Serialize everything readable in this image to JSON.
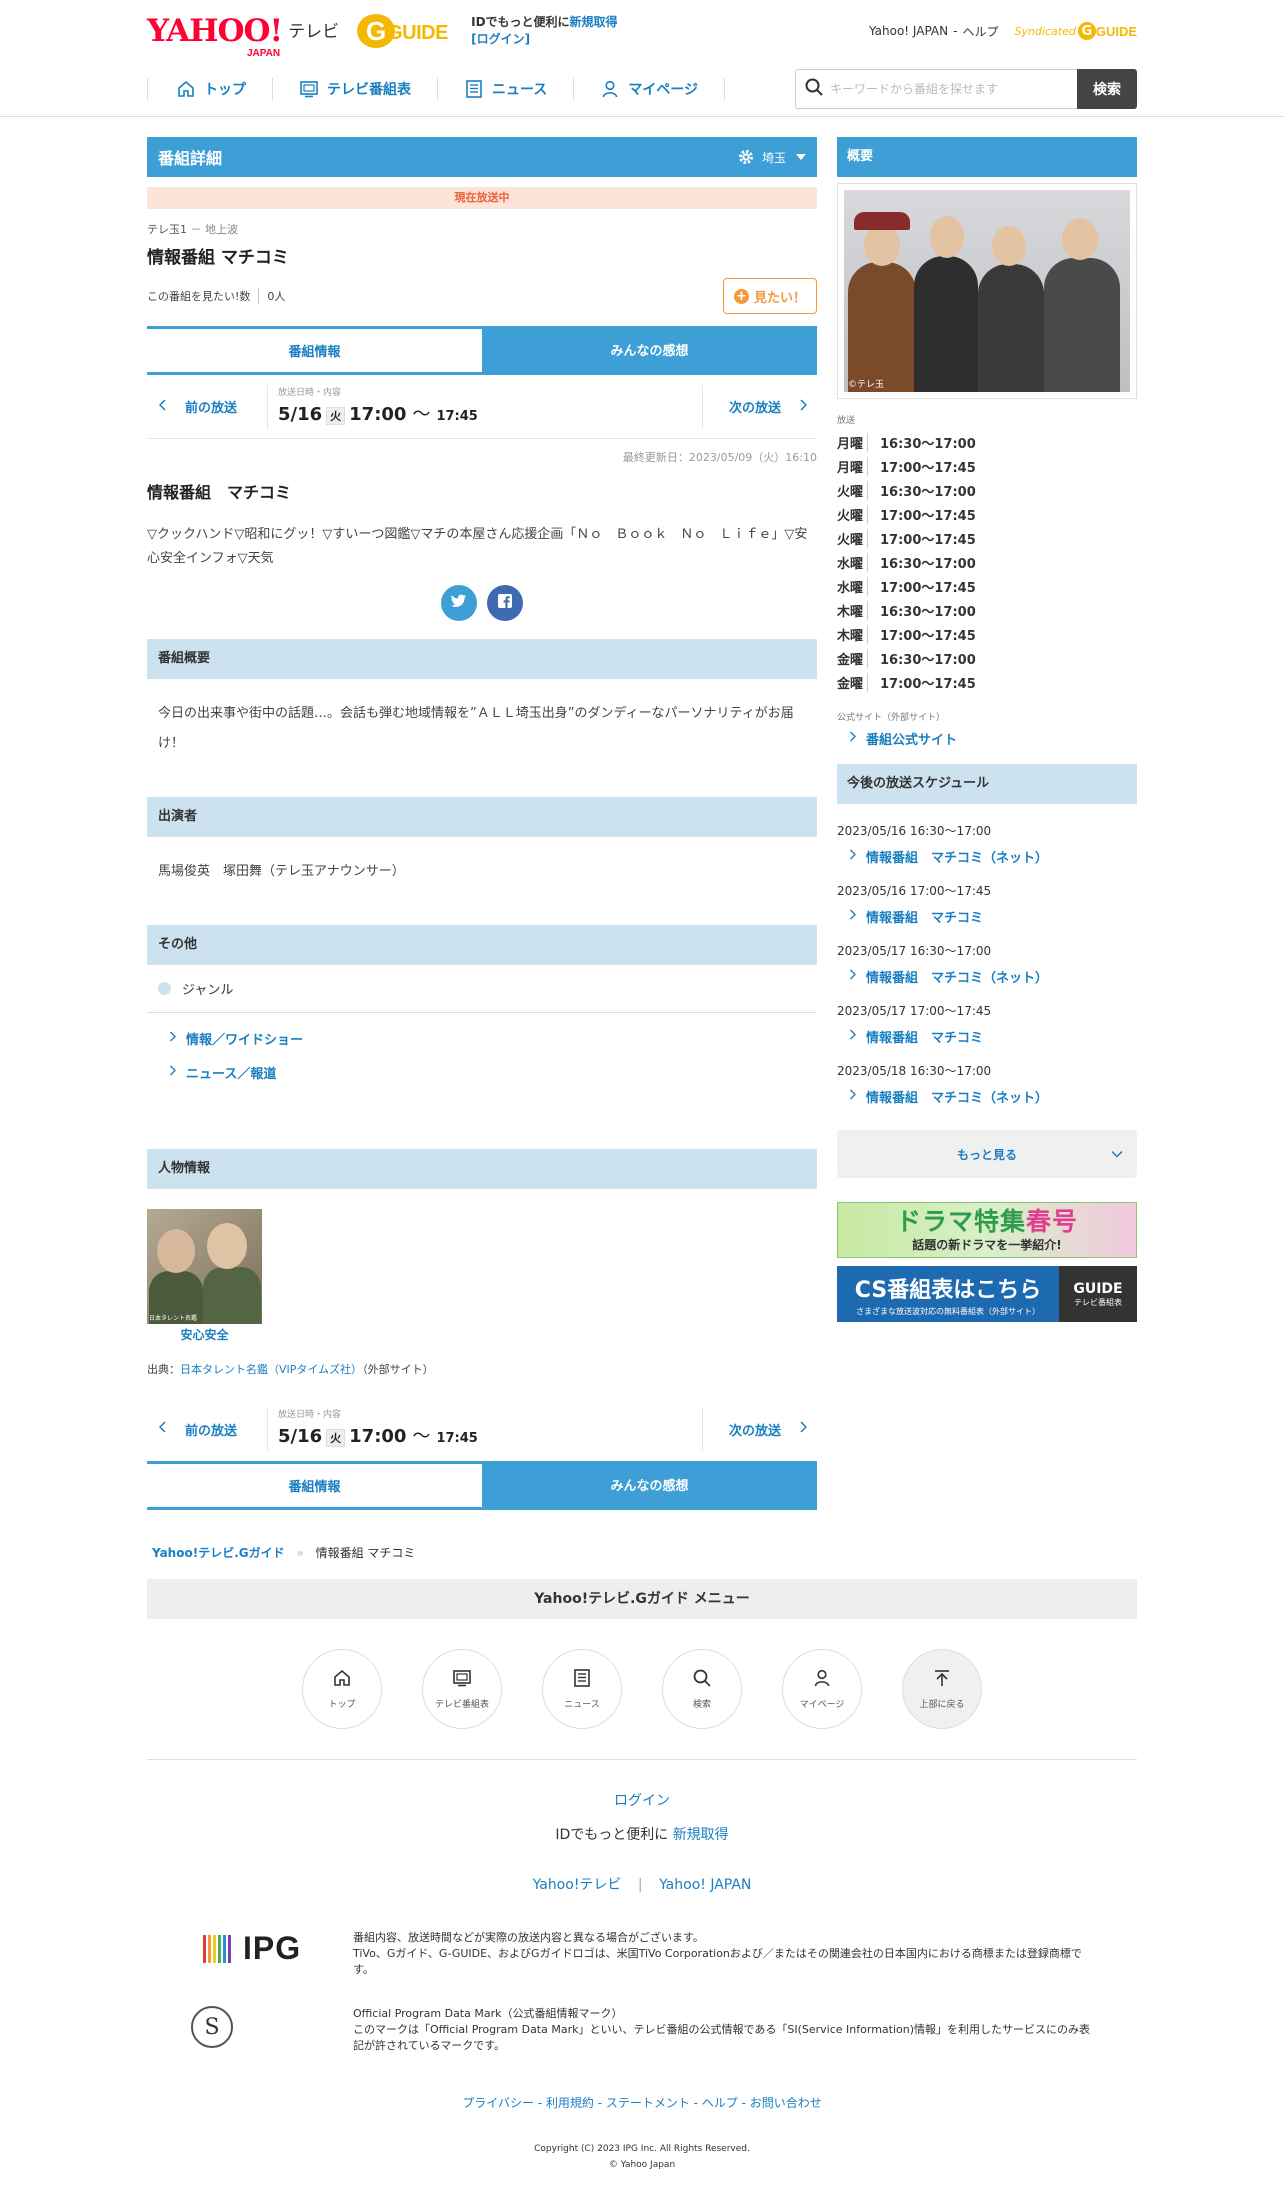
{
  "header": {
    "logo_yahoo": "YAHOO!",
    "logo_japan": "JAPAN",
    "logo_tv": "テレビ",
    "logo_g": "G",
    "logo_guide": "GUIDE",
    "id_text": "IDでもっと便利に",
    "register": "新規取得",
    "login": "[ログイン]",
    "yahoo_japan": "Yahoo! JAPAN",
    "sep": "-",
    "help": "ヘルプ",
    "syndicated": "Syndicated",
    "syndicated_g": "G",
    "syndicated_guide": "GUIDE"
  },
  "nav": {
    "items": [
      {
        "label": "トップ",
        "icon": "home-icon"
      },
      {
        "label": "テレビ番組表",
        "icon": "tv-icon"
      },
      {
        "label": "ニュース",
        "icon": "news-icon"
      },
      {
        "label": "マイページ",
        "icon": "user-icon"
      }
    ],
    "search_placeholder": "キーワードから番組を探せます",
    "search_button": "検索"
  },
  "detail": {
    "title": "番組詳細",
    "area": "埼玉",
    "on_air": "現在放送中",
    "channel": "テレ玉1",
    "channel_sep": "－",
    "channel_type": "地上波",
    "program_title": "情報番組 マチコミ",
    "want_label": "この番組を見たい!数",
    "want_count": "0人",
    "want_button": "見たい！",
    "tab_info": "番組情報",
    "tab_review": "みんなの感想",
    "prev": "前の放送",
    "next": "次の放送",
    "date_label": "放送日時・内容",
    "date": "5/16",
    "dow": "火",
    "start": "17:00",
    "tilde": "〜",
    "end": "17:45",
    "updated": "最終更新日：2023/05/09（火）16:10",
    "content_title": "情報番組　マチコミ",
    "content_text": "▽クックハンド▽昭和にグッ！▽すいーつ図鑑▽マチの本屋さん応援企画「Ｎｏ　Ｂｏｏｋ　Ｎｏ　Ｌｉｆｅ」▽安心安全インフォ▽天気",
    "summary_head": "番組概要",
    "summary": "今日の出来事や街中の話題…。会話も弾む地域情報を”ＡＬＬ埼玉出身”のダンディーなパーソナリティがお届け！",
    "cast_head": "出演者",
    "cast": "馬場俊英　塚田舞（テレ玉アナウンサー）",
    "other_head": "その他",
    "genre_label": "ジャンル",
    "genres": [
      "情報／ワイドショー",
      "ニュース／報道"
    ],
    "person_head": "人物情報",
    "person_name": "安心安全",
    "person_caption": "日本タレント名鑑",
    "source_prefix": "出典：",
    "source_link": "日本タレント名鑑（VIPタイムズ社）",
    "source_suffix": "（外部サイト）"
  },
  "breadcrumb": {
    "home": "Yahoo!テレビ.Gガイド",
    "sep": "»",
    "current": "情報番組 マチコミ"
  },
  "side": {
    "overview_head": "概要",
    "photo_caption": "©テレ玉",
    "broadcast_label": "放送",
    "broadcasts": [
      {
        "day": "月曜",
        "time": "16:30～17:00"
      },
      {
        "day": "月曜",
        "time": "17:00～17:45"
      },
      {
        "day": "火曜",
        "time": "16:30～17:00"
      },
      {
        "day": "火曜",
        "time": "17:00～17:45"
      },
      {
        "day": "火曜",
        "time": "17:00～17:45"
      },
      {
        "day": "水曜",
        "time": "16:30～17:00"
      },
      {
        "day": "水曜",
        "time": "17:00～17:45"
      },
      {
        "day": "木曜",
        "time": "16:30～17:00"
      },
      {
        "day": "木曜",
        "time": "17:00～17:45"
      },
      {
        "day": "金曜",
        "time": "16:30～17:00"
      },
      {
        "day": "金曜",
        "time": "17:00～17:45"
      }
    ],
    "official_label": "公式サイト（外部サイト）",
    "official_link": "番組公式サイト",
    "schedule_head": "今後の放送スケジュール",
    "schedule": [
      {
        "datetime": "2023/05/16 16:30～17:00",
        "title": "情報番組　マチコミ（ネット）"
      },
      {
        "datetime": "2023/05/16 17:00～17:45",
        "title": "情報番組　マチコミ"
      },
      {
        "datetime": "2023/05/17 16:30～17:00",
        "title": "情報番組　マチコミ（ネット）"
      },
      {
        "datetime": "2023/05/17 17:00～17:45",
        "title": "情報番組　マチコミ"
      },
      {
        "datetime": "2023/05/18 16:30～17:00",
        "title": "情報番組　マチコミ（ネット）"
      }
    ],
    "more": "もっと見る",
    "banner1_big_a": "ドラマ特集",
    "banner1_big_b": "春号",
    "banner1_small": "話題の新ドラマを一挙紹介!",
    "banner2_big": "CS番組表はこちら",
    "banner2_small": "さまざまな放送波対応の無料番組表（外部サイト）",
    "banner2_g": "GUIDE",
    "banner2_r": "テレビ番組表"
  },
  "footer_menu": {
    "head": "Yahoo!テレビ.Gガイド メニュー",
    "items": [
      {
        "label": "トップ",
        "icon": "home-icon"
      },
      {
        "label": "テレビ番組表",
        "icon": "tv-icon"
      },
      {
        "label": "ニュース",
        "icon": "news-icon"
      },
      {
        "label": "検索",
        "icon": "search-icon"
      },
      {
        "label": "マイページ",
        "icon": "user-icon"
      },
      {
        "label": "上部に戻る",
        "icon": "back-to-top-icon"
      }
    ]
  },
  "footer": {
    "login": "ログイン",
    "id_text": "IDでもっと便利に",
    "register": "新規取得",
    "link1": "Yahoo!テレビ",
    "link_sep": "|",
    "link2": "Yahoo! JAPAN",
    "ipg": "IPG",
    "legal1": "番組内容、放送時間などが実際の放送内容と異なる場合がございます。",
    "legal2": "TiVo、Gガイド、G-GUIDE、およびGガイドロゴは、米国TiVo Corporationおよび／またはその関連会社の日本国内における商標または登録商標です。",
    "s_mark": "S",
    "legal3": "Official Program Data Mark（公式番組情報マーク）",
    "legal4": "このマークは「Official Program Data Mark」といい、テレビ番組の公式情報である「SI(Service Information)情報」を利用したサービスにのみ表記が許されているマークです。",
    "bottom_links": "プライバシー - 利用規約 - ステートメント - ヘルプ - お問い合わせ",
    "copyright": "Copyright (C) 2023 IPG Inc. All Rights Reserved.",
    "copyright2": "© Yahoo Japan"
  },
  "colors": {
    "accent": "#3d9fd6",
    "link": "#1a7fc1",
    "on_air": "#e8613a",
    "want": "#f29a3b"
  }
}
